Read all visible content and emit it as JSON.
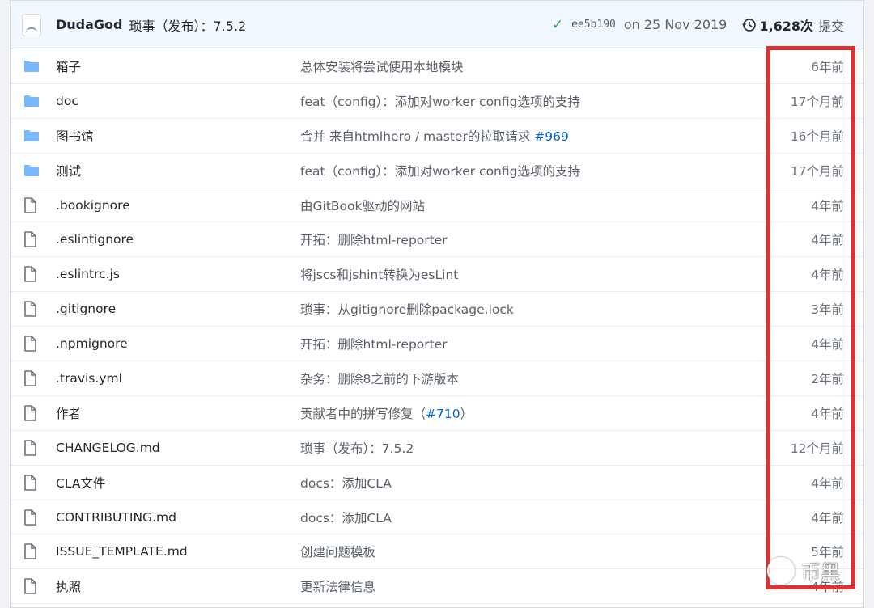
{
  "header": {
    "author": "DudaGod",
    "commit_message": "琐事（发布）：7.5.2",
    "check_icon": "check-icon",
    "sha": "ee5b190",
    "date": "on 25 Nov 2019",
    "history_icon": "history-icon",
    "commit_count": "1,628次",
    "commits_label": "提交"
  },
  "colors": {
    "folder": "#79b8ff",
    "file": "#6a737d",
    "link": "#0366d6",
    "highlight": "#e03131"
  },
  "rows": [
    {
      "type": "folder",
      "name": "箱子",
      "msg": "总体安装将尝试使用本地模块",
      "issue": "",
      "msg_after": "",
      "age": "6年前"
    },
    {
      "type": "folder",
      "name": "doc",
      "msg": "feat（config）：添加对worker config选项的支持",
      "issue": "",
      "msg_after": "",
      "age": "17个月前"
    },
    {
      "type": "folder",
      "name": "图书馆",
      "msg": "合并 来自htmlhero / master的拉取请求 ",
      "issue": "#969",
      "msg_after": "",
      "age": "16个月前"
    },
    {
      "type": "folder",
      "name": "测试",
      "msg": "feat（config）：添加对worker config选项的支持",
      "issue": "",
      "msg_after": "",
      "age": "17个月前"
    },
    {
      "type": "file",
      "name": ".bookignore",
      "msg": "由GitBook驱动的网站",
      "issue": "",
      "msg_after": "",
      "age": "4年前"
    },
    {
      "type": "file",
      "name": ".eslintignore",
      "msg": "开拓：删除html-reporter",
      "issue": "",
      "msg_after": "",
      "age": "4年前"
    },
    {
      "type": "file",
      "name": ".eslintrc.js",
      "msg": "将jscs和jshint转换为esLint",
      "issue": "",
      "msg_after": "",
      "age": "4年前"
    },
    {
      "type": "file",
      "name": ".gitignore",
      "msg": "琐事：从gitignore删除package.lock",
      "issue": "",
      "msg_after": "",
      "age": "3年前"
    },
    {
      "type": "file",
      "name": ".npmignore",
      "msg": "开拓：删除html-reporter",
      "issue": "",
      "msg_after": "",
      "age": "4年前"
    },
    {
      "type": "file",
      "name": ".travis.yml",
      "msg": "杂务：删除8之前的下游版本",
      "issue": "",
      "msg_after": "",
      "age": "2年前"
    },
    {
      "type": "file",
      "name": "作者",
      "msg": "贡献者中的拼写修复（",
      "issue": "#710",
      "msg_after": "）",
      "age": "4年前"
    },
    {
      "type": "file",
      "name": "CHANGELOG.md",
      "msg": "琐事（发布）：7.5.2",
      "issue": "",
      "msg_after": "",
      "age": "12个月前"
    },
    {
      "type": "file",
      "name": "CLA文件",
      "msg": "docs：添加CLA",
      "issue": "",
      "msg_after": "",
      "age": "4年前"
    },
    {
      "type": "file",
      "name": "CONTRIBUTING.md",
      "msg": "docs：添加CLA",
      "issue": "",
      "msg_after": "",
      "age": "4年前"
    },
    {
      "type": "file",
      "name": "ISSUE_TEMPLATE.md",
      "msg": "创建问题模板",
      "issue": "",
      "msg_after": "",
      "age": "5年前"
    },
    {
      "type": "file",
      "name": "执照",
      "msg": "更新法律信息",
      "issue": "",
      "msg_after": "",
      "age": "4年前"
    }
  ],
  "watermark": {
    "text": "币黑",
    "icon": "wechat-icon"
  }
}
